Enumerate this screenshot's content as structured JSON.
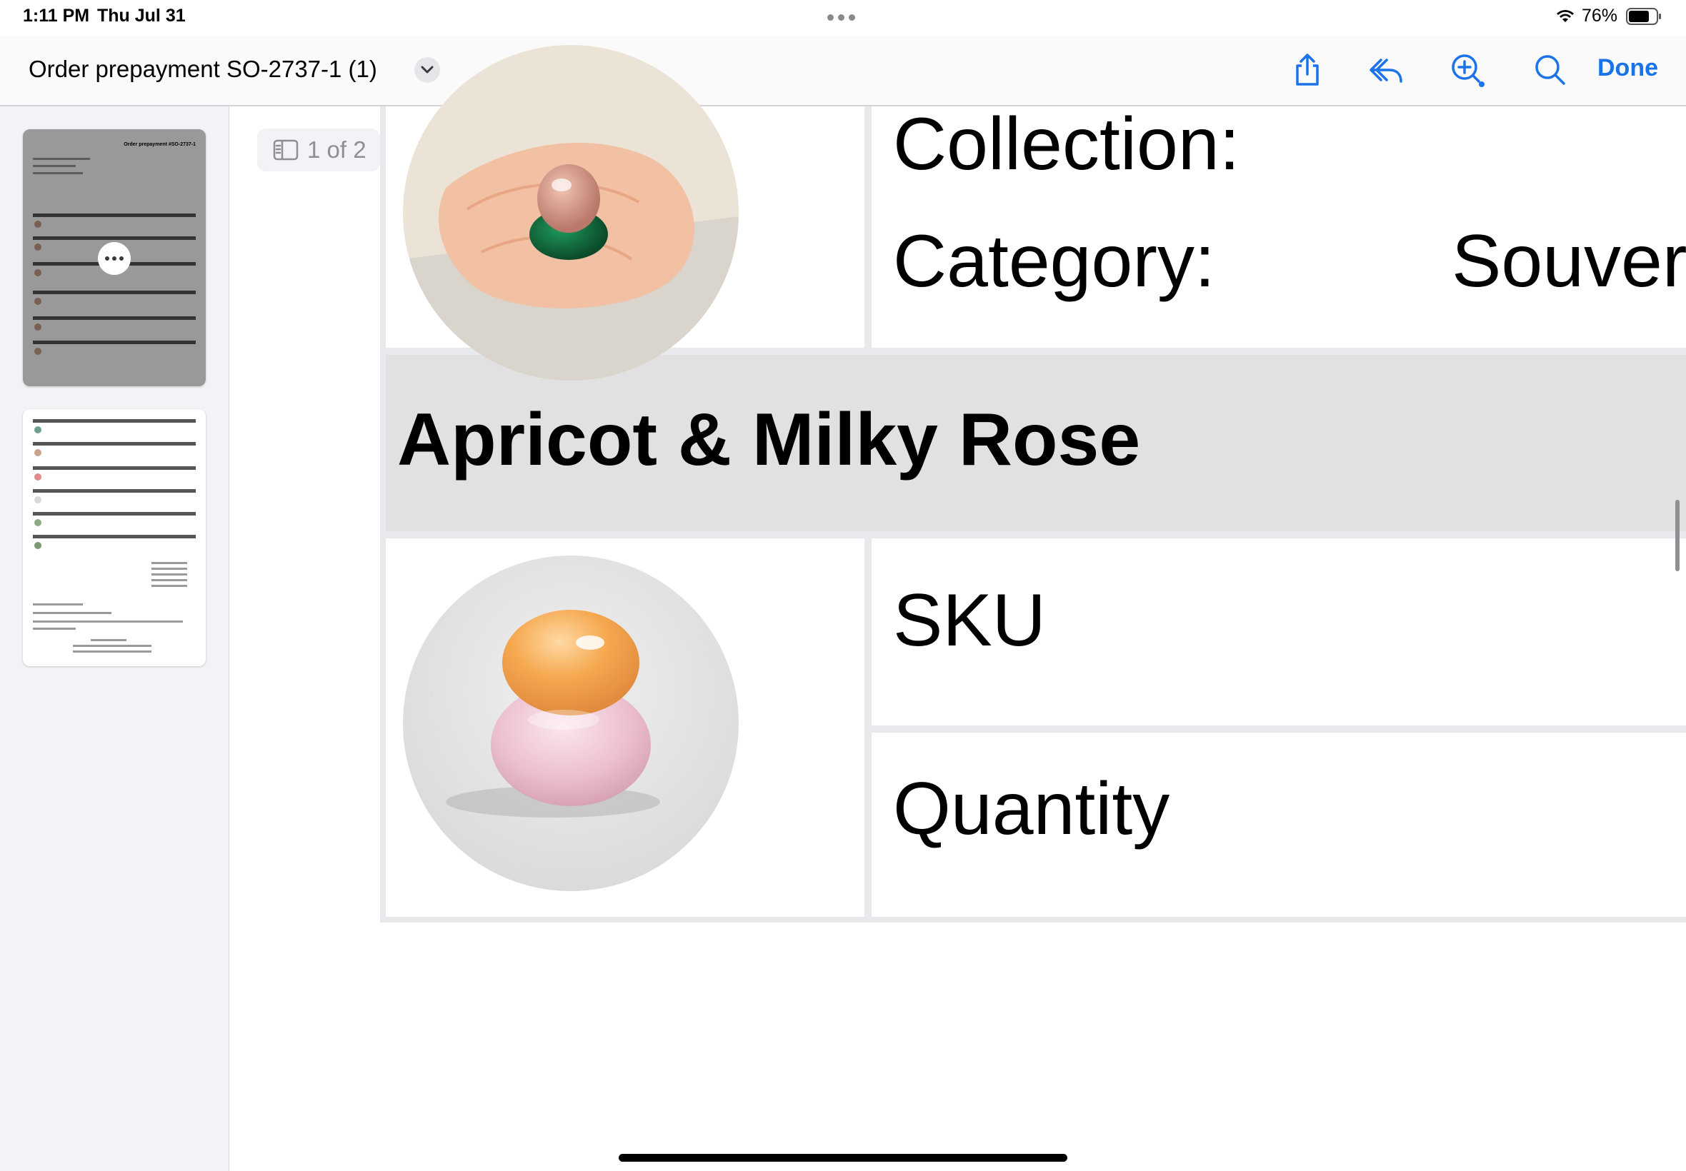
{
  "status_bar": {
    "time": "1:11 PM",
    "date": "Thu Jul 31",
    "battery_percent": "76%",
    "battery_level": 0.76
  },
  "nav": {
    "title": "Order prepayment SO-2737-1 (1)",
    "done_label": "Done",
    "icons": [
      "share-icon",
      "reply-icon",
      "zoom-in-icon",
      "search-icon",
      "chevron-down-icon"
    ],
    "accent_color": "#1a73e8"
  },
  "sidebar": {
    "thumbnails": [
      {
        "page": 1,
        "selected": true,
        "title": "Order prepayment #SO-2737-1"
      },
      {
        "page": 2,
        "selected": false
      }
    ]
  },
  "page_indicator": "1 of 2",
  "document": {
    "row1": {
      "collection_label": "Collection:",
      "category_label": "Category:",
      "category_value": "Souver"
    },
    "product_name": "Apricot & Milky Rose",
    "row2": {
      "sku_label": "SKU",
      "quantity_label": "Quantity"
    }
  }
}
